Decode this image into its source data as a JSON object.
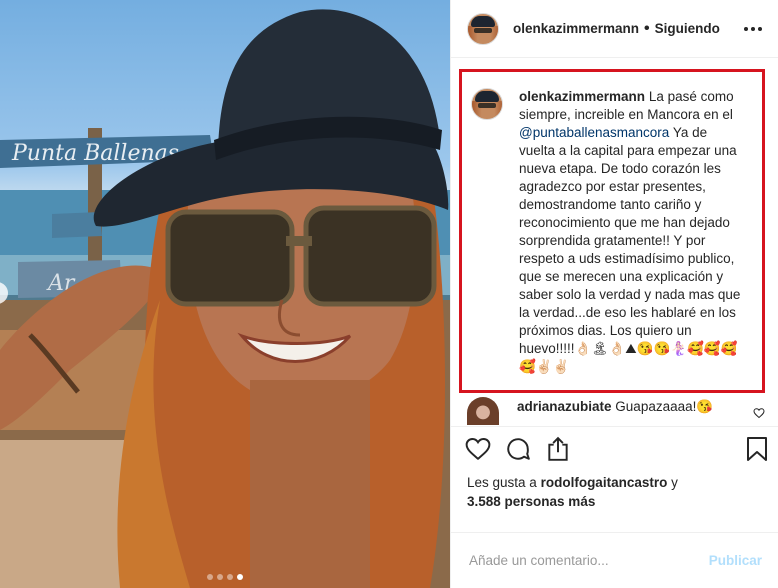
{
  "post": {
    "username": "olenkazimmermann",
    "separator": "•",
    "follow_status": "Siguiendo"
  },
  "photo": {
    "sign_text": "Punta Ballenas",
    "sign_text_2": "Ar",
    "carousel_count": 4,
    "carousel_active": 4
  },
  "caption": {
    "username": "olenkazimmermann",
    "text_part1": "La pasé como siempre, increible en Mancora en el",
    "mention": "@puntaballenasmancora",
    "text_part2": "Ya de vuelta a la capital para empezar una nueva etapa. De todo corazón les agradezco por estar presentes, demostrandome tanto cariño y reconocimiento que me han dejado sorprendida gratamente!! Y por respeto a uds estimadísimo publico, que se merecen una explicación y saber solo la verdad y nada mas que la verdad...de eso les hablaré en los próximos dias. Los quiero un huevo!!!!!👌🏻🏝👌🏻⛰😘😘🧜🏻‍♀️🥰🥰🥰🥰✌🏻✌🏻"
  },
  "comment": {
    "username": "adrianazubiate",
    "text": "Guapazaaaa!😘"
  },
  "likes": {
    "prefix": "Les gusta a",
    "user": "rodolfogaitancastro",
    "suffix": "y",
    "count": "3.588 personas más"
  },
  "add_comment": {
    "placeholder": "Añade un comentario...",
    "publish_label": "Publicar"
  },
  "colors": {
    "highlight": "#d6141f",
    "mention": "#003569",
    "publish": "#b2dffc"
  }
}
